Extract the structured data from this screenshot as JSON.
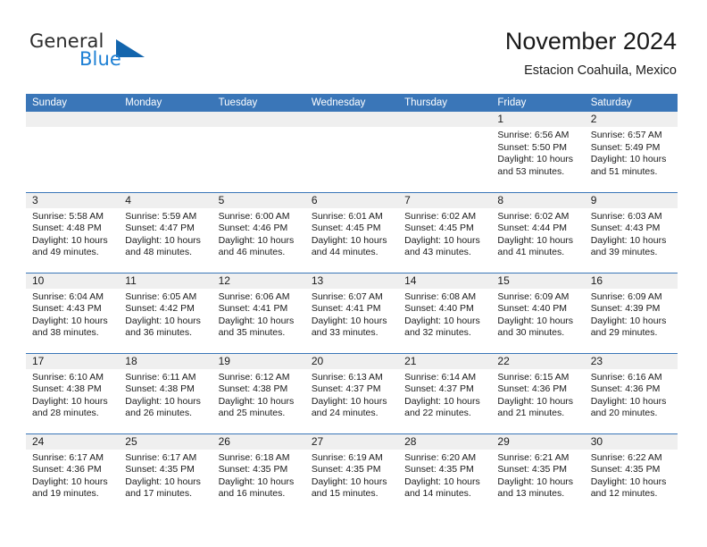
{
  "brand": {
    "name_part1": "General",
    "name_part2": "Blue",
    "logo_icon": "triangle-logo-icon"
  },
  "header": {
    "title": "November 2024",
    "subtitle": "Estacion Coahuila, Mexico"
  },
  "colors": {
    "header_blue": "#3a76b8",
    "brand_blue": "#1c7fd4",
    "logo_blue": "#1365ad",
    "daynum_band": "#efefef",
    "text": "#1a1a1a"
  },
  "weekdays": [
    "Sunday",
    "Monday",
    "Tuesday",
    "Wednesday",
    "Thursday",
    "Friday",
    "Saturday"
  ],
  "weeks": [
    [
      {
        "day": "",
        "lines": []
      },
      {
        "day": "",
        "lines": []
      },
      {
        "day": "",
        "lines": []
      },
      {
        "day": "",
        "lines": []
      },
      {
        "day": "",
        "lines": []
      },
      {
        "day": "1",
        "lines": [
          "Sunrise: 6:56 AM",
          "Sunset: 5:50 PM",
          "Daylight: 10 hours",
          "and 53 minutes."
        ]
      },
      {
        "day": "2",
        "lines": [
          "Sunrise: 6:57 AM",
          "Sunset: 5:49 PM",
          "Daylight: 10 hours",
          "and 51 minutes."
        ]
      }
    ],
    [
      {
        "day": "3",
        "lines": [
          "Sunrise: 5:58 AM",
          "Sunset: 4:48 PM",
          "Daylight: 10 hours",
          "and 49 minutes."
        ]
      },
      {
        "day": "4",
        "lines": [
          "Sunrise: 5:59 AM",
          "Sunset: 4:47 PM",
          "Daylight: 10 hours",
          "and 48 minutes."
        ]
      },
      {
        "day": "5",
        "lines": [
          "Sunrise: 6:00 AM",
          "Sunset: 4:46 PM",
          "Daylight: 10 hours",
          "and 46 minutes."
        ]
      },
      {
        "day": "6",
        "lines": [
          "Sunrise: 6:01 AM",
          "Sunset: 4:45 PM",
          "Daylight: 10 hours",
          "and 44 minutes."
        ]
      },
      {
        "day": "7",
        "lines": [
          "Sunrise: 6:02 AM",
          "Sunset: 4:45 PM",
          "Daylight: 10 hours",
          "and 43 minutes."
        ]
      },
      {
        "day": "8",
        "lines": [
          "Sunrise: 6:02 AM",
          "Sunset: 4:44 PM",
          "Daylight: 10 hours",
          "and 41 minutes."
        ]
      },
      {
        "day": "9",
        "lines": [
          "Sunrise: 6:03 AM",
          "Sunset: 4:43 PM",
          "Daylight: 10 hours",
          "and 39 minutes."
        ]
      }
    ],
    [
      {
        "day": "10",
        "lines": [
          "Sunrise: 6:04 AM",
          "Sunset: 4:43 PM",
          "Daylight: 10 hours",
          "and 38 minutes."
        ]
      },
      {
        "day": "11",
        "lines": [
          "Sunrise: 6:05 AM",
          "Sunset: 4:42 PM",
          "Daylight: 10 hours",
          "and 36 minutes."
        ]
      },
      {
        "day": "12",
        "lines": [
          "Sunrise: 6:06 AM",
          "Sunset: 4:41 PM",
          "Daylight: 10 hours",
          "and 35 minutes."
        ]
      },
      {
        "day": "13",
        "lines": [
          "Sunrise: 6:07 AM",
          "Sunset: 4:41 PM",
          "Daylight: 10 hours",
          "and 33 minutes."
        ]
      },
      {
        "day": "14",
        "lines": [
          "Sunrise: 6:08 AM",
          "Sunset: 4:40 PM",
          "Daylight: 10 hours",
          "and 32 minutes."
        ]
      },
      {
        "day": "15",
        "lines": [
          "Sunrise: 6:09 AM",
          "Sunset: 4:40 PM",
          "Daylight: 10 hours",
          "and 30 minutes."
        ]
      },
      {
        "day": "16",
        "lines": [
          "Sunrise: 6:09 AM",
          "Sunset: 4:39 PM",
          "Daylight: 10 hours",
          "and 29 minutes."
        ]
      }
    ],
    [
      {
        "day": "17",
        "lines": [
          "Sunrise: 6:10 AM",
          "Sunset: 4:38 PM",
          "Daylight: 10 hours",
          "and 28 minutes."
        ]
      },
      {
        "day": "18",
        "lines": [
          "Sunrise: 6:11 AM",
          "Sunset: 4:38 PM",
          "Daylight: 10 hours",
          "and 26 minutes."
        ]
      },
      {
        "day": "19",
        "lines": [
          "Sunrise: 6:12 AM",
          "Sunset: 4:38 PM",
          "Daylight: 10 hours",
          "and 25 minutes."
        ]
      },
      {
        "day": "20",
        "lines": [
          "Sunrise: 6:13 AM",
          "Sunset: 4:37 PM",
          "Daylight: 10 hours",
          "and 24 minutes."
        ]
      },
      {
        "day": "21",
        "lines": [
          "Sunrise: 6:14 AM",
          "Sunset: 4:37 PM",
          "Daylight: 10 hours",
          "and 22 minutes."
        ]
      },
      {
        "day": "22",
        "lines": [
          "Sunrise: 6:15 AM",
          "Sunset: 4:36 PM",
          "Daylight: 10 hours",
          "and 21 minutes."
        ]
      },
      {
        "day": "23",
        "lines": [
          "Sunrise: 6:16 AM",
          "Sunset: 4:36 PM",
          "Daylight: 10 hours",
          "and 20 minutes."
        ]
      }
    ],
    [
      {
        "day": "24",
        "lines": [
          "Sunrise: 6:17 AM",
          "Sunset: 4:36 PM",
          "Daylight: 10 hours",
          "and 19 minutes."
        ]
      },
      {
        "day": "25",
        "lines": [
          "Sunrise: 6:17 AM",
          "Sunset: 4:35 PM",
          "Daylight: 10 hours",
          "and 17 minutes."
        ]
      },
      {
        "day": "26",
        "lines": [
          "Sunrise: 6:18 AM",
          "Sunset: 4:35 PM",
          "Daylight: 10 hours",
          "and 16 minutes."
        ]
      },
      {
        "day": "27",
        "lines": [
          "Sunrise: 6:19 AM",
          "Sunset: 4:35 PM",
          "Daylight: 10 hours",
          "and 15 minutes."
        ]
      },
      {
        "day": "28",
        "lines": [
          "Sunrise: 6:20 AM",
          "Sunset: 4:35 PM",
          "Daylight: 10 hours",
          "and 14 minutes."
        ]
      },
      {
        "day": "29",
        "lines": [
          "Sunrise: 6:21 AM",
          "Sunset: 4:35 PM",
          "Daylight: 10 hours",
          "and 13 minutes."
        ]
      },
      {
        "day": "30",
        "lines": [
          "Sunrise: 6:22 AM",
          "Sunset: 4:35 PM",
          "Daylight: 10 hours",
          "and 12 minutes."
        ]
      }
    ]
  ]
}
